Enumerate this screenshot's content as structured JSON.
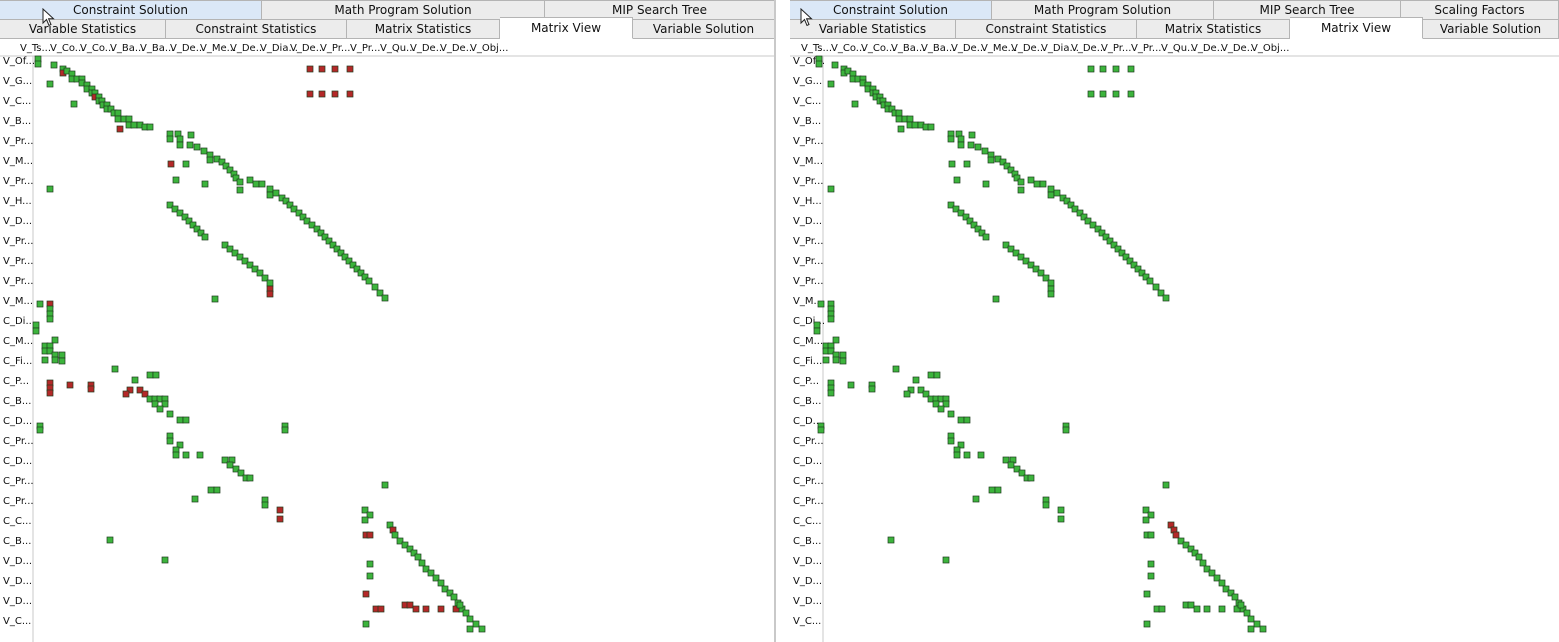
{
  "left_panel": {
    "tabs_row1": [
      "Constraint Solution",
      "Math Program Solution",
      "MIP Search Tree"
    ],
    "tabs_row2": [
      "Variable Statistics",
      "Constraint Statistics",
      "Matrix Statistics",
      "Matrix View",
      "Variable Solution"
    ],
    "highlighted_tab": "Constraint Solution",
    "selected_tab": "Matrix View"
  },
  "right_panel": {
    "tabs_row1": [
      "Constraint Solution",
      "Math Program Solution",
      "MIP Search Tree",
      "Scaling Factors"
    ],
    "tabs_row2": [
      "Variable Statistics",
      "Constraint Statistics",
      "Matrix Statistics",
      "Matrix View",
      "Variable Solution"
    ],
    "highlighted_tab": "Constraint Solution",
    "selected_tab": "Matrix View"
  },
  "matrix": {
    "column_labels": [
      "V_Ts...",
      "V_Co...",
      "V_Co...",
      "V_Ba...",
      "V_Ba...",
      "V_De...",
      "V_Me...",
      "V_De...",
      "V_Dia...",
      "V_De...",
      "V_Pr...",
      "V_Pr...",
      "V_Qu...",
      "V_De...",
      "V_De...",
      "V_Obj..."
    ],
    "row_labels": [
      "V_Of...",
      "V_G...",
      "V_C...",
      "V_B...",
      "V_Pr...",
      "V_M...",
      "V_Pr...",
      "V_H...",
      "V_D...",
      "V_Pr...",
      "V_Pr...",
      "V_Pr...",
      "V_M...",
      "C_Di...",
      "C_M...",
      "C_Fi...",
      "C_P...",
      "C_B...",
      "C_D...",
      "C_Pr...",
      "C_D...",
      "C_Pr...",
      "C_Pr...",
      "C_C...",
      "C_B...",
      "V_D...",
      "V_D...",
      "V_D...",
      "V_C..."
    ],
    "colors": {
      "positive": "#3cb43c",
      "negative": "#b42828",
      "border": "#1e3c1e"
    }
  }
}
